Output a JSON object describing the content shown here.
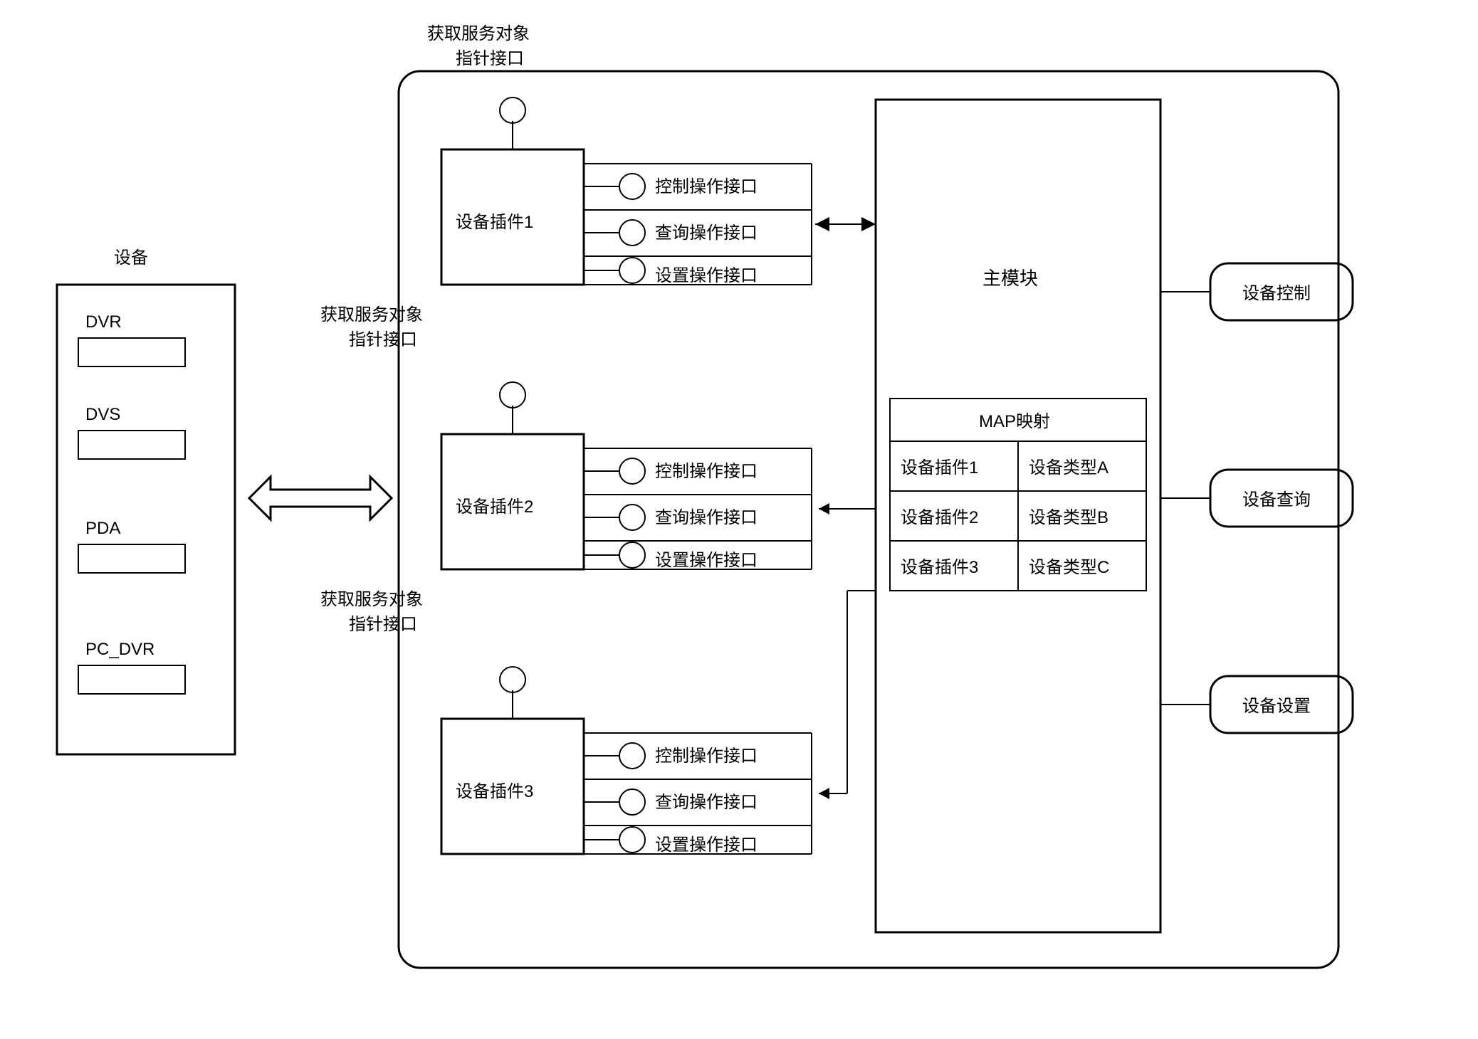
{
  "header": {
    "pointerLabel1": "获取服务对象",
    "pointerLabel2": "指针接口"
  },
  "devicePanel": {
    "title": "设备",
    "items": [
      "DVR",
      "DVS",
      "PDA",
      "PC_DVR"
    ]
  },
  "plugins": [
    {
      "name": "设备插件1",
      "pointerL1": "获取服务对象",
      "pointerL2": "指针接口",
      "interfaces": [
        "控制操作接口",
        "查询操作接口",
        "设置操作接口"
      ]
    },
    {
      "name": "设备插件2",
      "pointerL1": "获取服务对象",
      "pointerL2": "指针接口",
      "interfaces": [
        "控制操作接口",
        "查询操作接口",
        "设置操作接口"
      ]
    },
    {
      "name": "设备插件3",
      "pointerL1": "获取服务对象",
      "pointerL2": "指针接口",
      "interfaces": [
        "控制操作接口",
        "查询操作接口",
        "设置操作接口"
      ]
    }
  ],
  "mainModule": {
    "title": "主模块",
    "mapTitle": "MAP映射",
    "rows": [
      {
        "plugin": "设备插件1",
        "type": "设备类型A"
      },
      {
        "plugin": "设备插件2",
        "type": "设备类型B"
      },
      {
        "plugin": "设备插件3",
        "type": "设备类型C"
      }
    ]
  },
  "actions": [
    "设备控制",
    "设备查询",
    "设备设置"
  ]
}
